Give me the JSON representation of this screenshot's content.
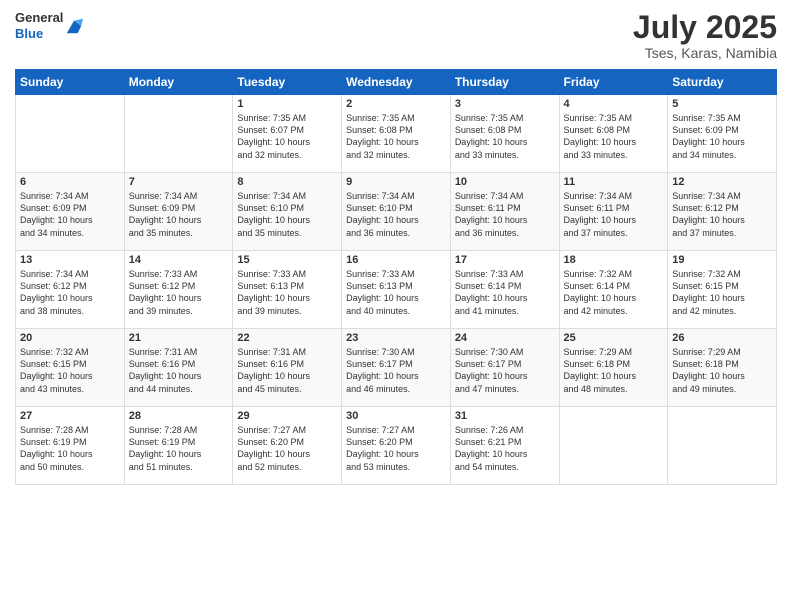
{
  "header": {
    "logo_general": "General",
    "logo_blue": "Blue",
    "month_year": "July 2025",
    "location": "Tses, Karas, Namibia"
  },
  "weekdays": [
    "Sunday",
    "Monday",
    "Tuesday",
    "Wednesday",
    "Thursday",
    "Friday",
    "Saturday"
  ],
  "weeks": [
    [
      {
        "day": "",
        "info": ""
      },
      {
        "day": "",
        "info": ""
      },
      {
        "day": "1",
        "info": "Sunrise: 7:35 AM\nSunset: 6:07 PM\nDaylight: 10 hours\nand 32 minutes."
      },
      {
        "day": "2",
        "info": "Sunrise: 7:35 AM\nSunset: 6:08 PM\nDaylight: 10 hours\nand 32 minutes."
      },
      {
        "day": "3",
        "info": "Sunrise: 7:35 AM\nSunset: 6:08 PM\nDaylight: 10 hours\nand 33 minutes."
      },
      {
        "day": "4",
        "info": "Sunrise: 7:35 AM\nSunset: 6:08 PM\nDaylight: 10 hours\nand 33 minutes."
      },
      {
        "day": "5",
        "info": "Sunrise: 7:35 AM\nSunset: 6:09 PM\nDaylight: 10 hours\nand 34 minutes."
      }
    ],
    [
      {
        "day": "6",
        "info": "Sunrise: 7:34 AM\nSunset: 6:09 PM\nDaylight: 10 hours\nand 34 minutes."
      },
      {
        "day": "7",
        "info": "Sunrise: 7:34 AM\nSunset: 6:09 PM\nDaylight: 10 hours\nand 35 minutes."
      },
      {
        "day": "8",
        "info": "Sunrise: 7:34 AM\nSunset: 6:10 PM\nDaylight: 10 hours\nand 35 minutes."
      },
      {
        "day": "9",
        "info": "Sunrise: 7:34 AM\nSunset: 6:10 PM\nDaylight: 10 hours\nand 36 minutes."
      },
      {
        "day": "10",
        "info": "Sunrise: 7:34 AM\nSunset: 6:11 PM\nDaylight: 10 hours\nand 36 minutes."
      },
      {
        "day": "11",
        "info": "Sunrise: 7:34 AM\nSunset: 6:11 PM\nDaylight: 10 hours\nand 37 minutes."
      },
      {
        "day": "12",
        "info": "Sunrise: 7:34 AM\nSunset: 6:12 PM\nDaylight: 10 hours\nand 37 minutes."
      }
    ],
    [
      {
        "day": "13",
        "info": "Sunrise: 7:34 AM\nSunset: 6:12 PM\nDaylight: 10 hours\nand 38 minutes."
      },
      {
        "day": "14",
        "info": "Sunrise: 7:33 AM\nSunset: 6:12 PM\nDaylight: 10 hours\nand 39 minutes."
      },
      {
        "day": "15",
        "info": "Sunrise: 7:33 AM\nSunset: 6:13 PM\nDaylight: 10 hours\nand 39 minutes."
      },
      {
        "day": "16",
        "info": "Sunrise: 7:33 AM\nSunset: 6:13 PM\nDaylight: 10 hours\nand 40 minutes."
      },
      {
        "day": "17",
        "info": "Sunrise: 7:33 AM\nSunset: 6:14 PM\nDaylight: 10 hours\nand 41 minutes."
      },
      {
        "day": "18",
        "info": "Sunrise: 7:32 AM\nSunset: 6:14 PM\nDaylight: 10 hours\nand 42 minutes."
      },
      {
        "day": "19",
        "info": "Sunrise: 7:32 AM\nSunset: 6:15 PM\nDaylight: 10 hours\nand 42 minutes."
      }
    ],
    [
      {
        "day": "20",
        "info": "Sunrise: 7:32 AM\nSunset: 6:15 PM\nDaylight: 10 hours\nand 43 minutes."
      },
      {
        "day": "21",
        "info": "Sunrise: 7:31 AM\nSunset: 6:16 PM\nDaylight: 10 hours\nand 44 minutes."
      },
      {
        "day": "22",
        "info": "Sunrise: 7:31 AM\nSunset: 6:16 PM\nDaylight: 10 hours\nand 45 minutes."
      },
      {
        "day": "23",
        "info": "Sunrise: 7:30 AM\nSunset: 6:17 PM\nDaylight: 10 hours\nand 46 minutes."
      },
      {
        "day": "24",
        "info": "Sunrise: 7:30 AM\nSunset: 6:17 PM\nDaylight: 10 hours\nand 47 minutes."
      },
      {
        "day": "25",
        "info": "Sunrise: 7:29 AM\nSunset: 6:18 PM\nDaylight: 10 hours\nand 48 minutes."
      },
      {
        "day": "26",
        "info": "Sunrise: 7:29 AM\nSunset: 6:18 PM\nDaylight: 10 hours\nand 49 minutes."
      }
    ],
    [
      {
        "day": "27",
        "info": "Sunrise: 7:28 AM\nSunset: 6:19 PM\nDaylight: 10 hours\nand 50 minutes."
      },
      {
        "day": "28",
        "info": "Sunrise: 7:28 AM\nSunset: 6:19 PM\nDaylight: 10 hours\nand 51 minutes."
      },
      {
        "day": "29",
        "info": "Sunrise: 7:27 AM\nSunset: 6:20 PM\nDaylight: 10 hours\nand 52 minutes."
      },
      {
        "day": "30",
        "info": "Sunrise: 7:27 AM\nSunset: 6:20 PM\nDaylight: 10 hours\nand 53 minutes."
      },
      {
        "day": "31",
        "info": "Sunrise: 7:26 AM\nSunset: 6:21 PM\nDaylight: 10 hours\nand 54 minutes."
      },
      {
        "day": "",
        "info": ""
      },
      {
        "day": "",
        "info": ""
      }
    ]
  ]
}
